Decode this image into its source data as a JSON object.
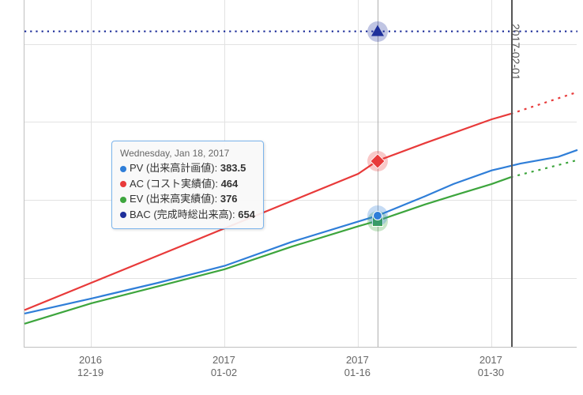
{
  "chart_data": {
    "type": "line",
    "title": "",
    "xlabel": "",
    "ylabel": "",
    "xlim_dates": [
      "2016-12-12",
      "2017-02-08"
    ],
    "ylim": [
      190,
      700
    ],
    "reference_line": {
      "date": "2017-02-01",
      "label": "2017-02-01"
    },
    "x_ticks": [
      {
        "date": "2016-12-19",
        "line1": "2016",
        "line2": "12-19"
      },
      {
        "date": "2017-01-02",
        "line1": "2017",
        "line2": "01-02"
      },
      {
        "date": "2017-01-16",
        "line1": "2017",
        "line2": "01-16"
      },
      {
        "date": "2017-01-30",
        "line1": "2017",
        "line2": "01-30"
      }
    ],
    "series": [
      {
        "name": "PV",
        "label": "PV (出来高計画値)",
        "color": "#2f7ed8",
        "marker_shape": "circle",
        "points": [
          {
            "x": "2016-12-12",
            "y": 240
          },
          {
            "x": "2016-12-19",
            "y": 262
          },
          {
            "x": "2016-12-26",
            "y": 285
          },
          {
            "x": "2017-01-02",
            "y": 310
          },
          {
            "x": "2017-01-09",
            "y": 345
          },
          {
            "x": "2017-01-16",
            "y": 375
          },
          {
            "x": "2017-01-18",
            "y": 383.5
          },
          {
            "x": "2017-01-23",
            "y": 412
          },
          {
            "x": "2017-01-26",
            "y": 430
          },
          {
            "x": "2017-01-30",
            "y": 450
          },
          {
            "x": "2017-02-02",
            "y": 460
          },
          {
            "x": "2017-02-06",
            "y": 470
          },
          {
            "x": "2017-02-08",
            "y": 480
          }
        ]
      },
      {
        "name": "AC",
        "label": "AC (コスト実績値)",
        "color": "#e83a3a",
        "marker_shape": "diamond",
        "points": [
          {
            "x": "2016-12-12",
            "y": 245
          },
          {
            "x": "2016-12-19",
            "y": 285
          },
          {
            "x": "2016-12-26",
            "y": 325
          },
          {
            "x": "2017-01-02",
            "y": 365
          },
          {
            "x": "2017-01-09",
            "y": 405
          },
          {
            "x": "2017-01-16",
            "y": 445
          },
          {
            "x": "2017-01-18",
            "y": 464
          },
          {
            "x": "2017-01-23",
            "y": 490
          },
          {
            "x": "2017-01-30",
            "y": 525
          },
          {
            "x": "2017-02-01",
            "y": 533
          }
        ],
        "forecast_points": [
          {
            "x": "2017-02-01",
            "y": 533
          },
          {
            "x": "2017-02-08",
            "y": 565
          }
        ]
      },
      {
        "name": "EV",
        "label": "EV (出来高実績値)",
        "color": "#3da53d",
        "marker_shape": "square",
        "points": [
          {
            "x": "2016-12-12",
            "y": 225
          },
          {
            "x": "2016-12-19",
            "y": 255
          },
          {
            "x": "2016-12-26",
            "y": 280
          },
          {
            "x": "2017-01-02",
            "y": 305
          },
          {
            "x": "2017-01-09",
            "y": 338
          },
          {
            "x": "2017-01-16",
            "y": 368
          },
          {
            "x": "2017-01-18",
            "y": 376
          },
          {
            "x": "2017-01-23",
            "y": 400
          },
          {
            "x": "2017-01-26",
            "y": 413
          },
          {
            "x": "2017-01-30",
            "y": 430
          },
          {
            "x": "2017-02-01",
            "y": 440
          }
        ],
        "forecast_points": [
          {
            "x": "2017-02-01",
            "y": 440
          },
          {
            "x": "2017-02-08",
            "y": 465
          }
        ]
      },
      {
        "name": "BAC",
        "label": "BAC (完成時総出来高)",
        "color": "#1e2f9a",
        "marker_shape": "triangle",
        "style": "dotted-horizontal",
        "value": 654
      }
    ],
    "tooltip": {
      "date_label": "Wednesday, Jan 18, 2017",
      "hover_date": "2017-01-18",
      "rows": [
        {
          "color": "#2f7ed8",
          "text": "PV (出来高計画値): ",
          "value": "383.5"
        },
        {
          "color": "#e83a3a",
          "text": "AC (コスト実績値): ",
          "value": "464"
        },
        {
          "color": "#3da53d",
          "text": "EV (出来高実績値): ",
          "value": "376"
        },
        {
          "color": "#1e2f9a",
          "text": "BAC (完成時総出来高): ",
          "value": "654"
        }
      ]
    }
  }
}
